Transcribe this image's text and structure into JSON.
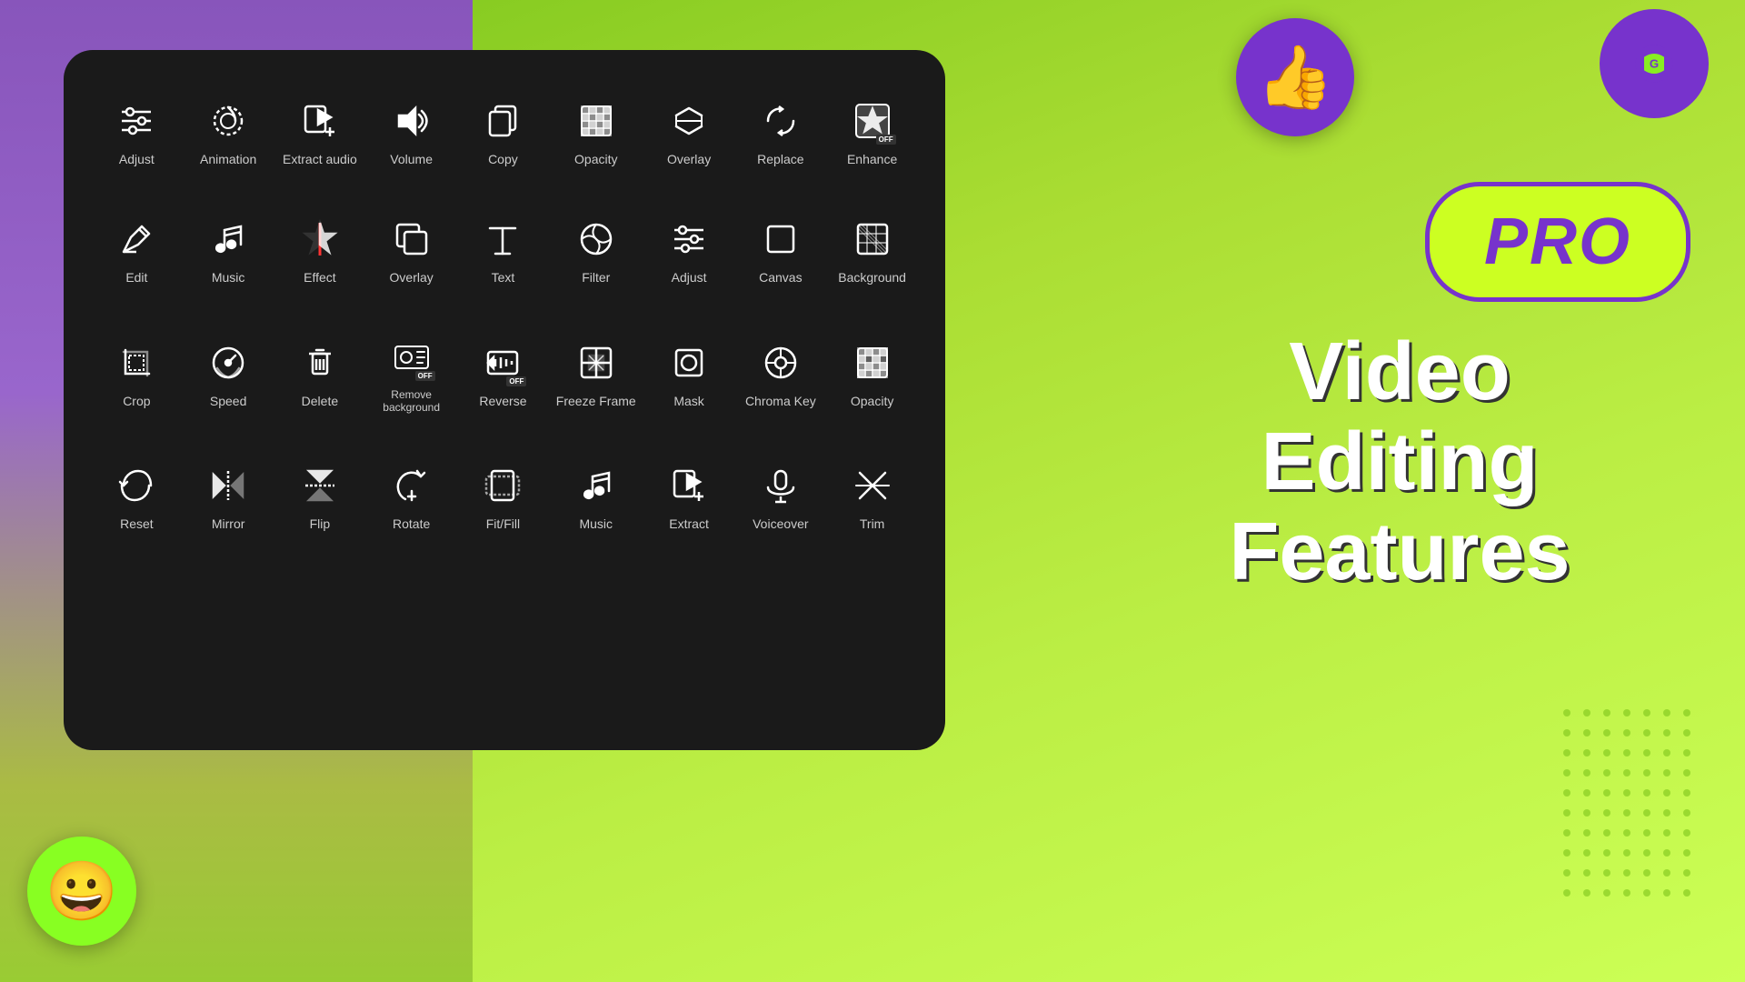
{
  "panel": {
    "title": "Video Editing Features"
  },
  "rows": [
    {
      "tools": [
        {
          "id": "adjust",
          "label": "Adjust",
          "icon": "adjust"
        },
        {
          "id": "animation",
          "label": "Animation",
          "icon": "animation"
        },
        {
          "id": "extract-audio",
          "label": "Extract audio",
          "icon": "extract-audio"
        },
        {
          "id": "volume",
          "label": "Volume",
          "icon": "volume"
        },
        {
          "id": "copy",
          "label": "Copy",
          "icon": "copy"
        },
        {
          "id": "opacity",
          "label": "Opacity",
          "icon": "opacity"
        },
        {
          "id": "overlay",
          "label": "Overlay",
          "icon": "overlay"
        },
        {
          "id": "replace",
          "label": "Replace",
          "icon": "replace"
        },
        {
          "id": "enhance",
          "label": "Enhance",
          "icon": "enhance"
        }
      ]
    },
    {
      "tools": [
        {
          "id": "edit",
          "label": "Edit",
          "icon": "edit"
        },
        {
          "id": "music",
          "label": "Music",
          "icon": "music"
        },
        {
          "id": "effect",
          "label": "Effect",
          "icon": "effect"
        },
        {
          "id": "overlay2",
          "label": "Overlay",
          "icon": "overlay2"
        },
        {
          "id": "text",
          "label": "Text",
          "icon": "text"
        },
        {
          "id": "filter",
          "label": "Filter",
          "icon": "filter"
        },
        {
          "id": "adjust2",
          "label": "Adjust",
          "icon": "adjust2"
        },
        {
          "id": "canvas",
          "label": "Canvas",
          "icon": "canvas"
        },
        {
          "id": "background",
          "label": "Background",
          "icon": "background"
        }
      ]
    },
    {
      "tools": [
        {
          "id": "crop",
          "label": "Crop",
          "icon": "crop"
        },
        {
          "id": "speed",
          "label": "Speed",
          "icon": "speed"
        },
        {
          "id": "delete",
          "label": "Delete",
          "icon": "delete"
        },
        {
          "id": "remove-bg",
          "label": "Remove background",
          "icon": "remove-bg"
        },
        {
          "id": "reverse",
          "label": "Reverse",
          "icon": "reverse"
        },
        {
          "id": "freeze-frame",
          "label": "Freeze Frame",
          "icon": "freeze-frame"
        },
        {
          "id": "mask",
          "label": "Mask",
          "icon": "mask"
        },
        {
          "id": "chroma-key",
          "label": "Chroma Key",
          "icon": "chroma-key"
        },
        {
          "id": "opacity2",
          "label": "Opacity",
          "icon": "opacity2"
        }
      ]
    },
    {
      "tools": [
        {
          "id": "reset",
          "label": "Reset",
          "icon": "reset"
        },
        {
          "id": "mirror",
          "label": "Mirror",
          "icon": "mirror"
        },
        {
          "id": "flip",
          "label": "Flip",
          "icon": "flip"
        },
        {
          "id": "rotate",
          "label": "Rotate",
          "icon": "rotate"
        },
        {
          "id": "fit-fill",
          "label": "Fit/Fill",
          "icon": "fit-fill"
        },
        {
          "id": "music2",
          "label": "Music",
          "icon": "music2"
        },
        {
          "id": "extract",
          "label": "Extract",
          "icon": "extract"
        },
        {
          "id": "voiceover",
          "label": "Voiceover",
          "icon": "voiceover"
        },
        {
          "id": "trim",
          "label": "Trim",
          "icon": "trim"
        }
      ]
    }
  ],
  "right": {
    "pro_label": "PRO",
    "line1": "Video",
    "line2": "Editing",
    "line3": "Features"
  }
}
